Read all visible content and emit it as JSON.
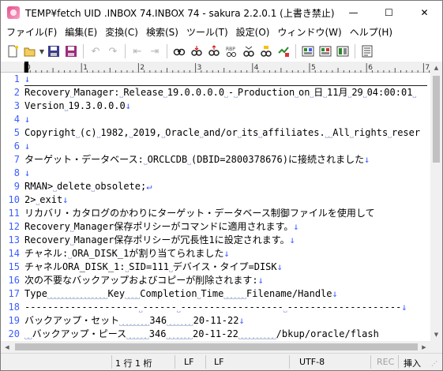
{
  "title": "TEMP¥fetch UID .INBOX 74.INBOX 74 - sakura 2.2.0.1 (上書き禁止)",
  "window_controls": [
    "—",
    "☐",
    "✕"
  ],
  "menu": [
    "ファイル(F)",
    "編集(E)",
    "変換(C)",
    "検索(S)",
    "ツール(T)",
    "設定(O)",
    "ウィンドウ(W)",
    "ヘルプ(H)"
  ],
  "toolbar": {
    "icons": [
      "new-file",
      "open",
      "save",
      "save-all",
      "undo",
      "redo",
      "jump-back",
      "jump-forward",
      "search",
      "search-next",
      "search-prev",
      "replace",
      "bookmark",
      "jump",
      "grep",
      "tag",
      "compare",
      "outline"
    ]
  },
  "ruler": {
    "labels": [
      "0",
      "1",
      "2",
      "3",
      "4",
      "5",
      "6",
      "7"
    ]
  },
  "lines": [
    {
      "n": "1",
      "t": "↓"
    },
    {
      "n": "2",
      "t": "Recovery˽Manager:˽Release˽19.0.0.0.0˽-˽Production˽on˽日˽11月˽29˽04:00:01˽"
    },
    {
      "n": "3",
      "t": "Version˽19.3.0.0.0↓"
    },
    {
      "n": "4",
      "t": "↓"
    },
    {
      "n": "5",
      "t": "Copyright˽(c)˽1982,˽2019,˽Oracle˽and/or˽its˽affiliates.˽˽All˽rights˽reser"
    },
    {
      "n": "6",
      "t": "↓"
    },
    {
      "n": "7",
      "t": "ターゲット・データベース:˽ORCLCDB˽(DBID=2800378676)に接続されました↓"
    },
    {
      "n": "8",
      "t": "↓"
    },
    {
      "n": "9",
      "t": "RMAN>˽delete˽obsolete;↵"
    },
    {
      "n": "10",
      "t": "2>˽exit↓"
    },
    {
      "n": "11",
      "t": "リカバリ・カタログのかわりにターゲット・データベース制御ファイルを使用して"
    },
    {
      "n": "12",
      "t": "Recovery˽Manager保存ポリシーがコマンドに適用されます。↓"
    },
    {
      "n": "13",
      "t": "Recovery˽Manager保存ポリシーが冗長性1に設定されます。↓"
    },
    {
      "n": "14",
      "t": "チャネル:˽ORA_DISK_1が割り当てられました↓"
    },
    {
      "n": "15",
      "t": "チャネルORA_DISK_1:˽SID=111˽デバイス・タイプ=DISK↓"
    },
    {
      "n": "16",
      "t": "次の不要なバックアップおよびコピーが削除されます:↓"
    },
    {
      "n": "17",
      "t": "Type˽˽˽˽˽˽˽˽˽˽˽˽˽˽˽˽Key˽˽˽˽Completion˽Time˽˽˽˽˽˽Filename/Handle↓"
    },
    {
      "n": "18",
      "t": "--------------------˽------˽------------------˽--------------------↓"
    },
    {
      "n": "19",
      "t": "バックアップ・セット˽˽˽˽˽˽˽˽346˽˽˽˽˽˽˽20-11-22↓"
    },
    {
      "n": "20",
      "t": "˽˽バックアップ・ピース˽˽˽˽˽˽346˽˽˽˽˽˽˽20-11-22˽˽˽˽˽˽˽˽˽˽/bkup/oracle/flash"
    }
  ],
  "status": {
    "position": "1 行   1 桁",
    "eol1": "LF",
    "eol2": "LF",
    "encoding": "UTF-8",
    "rec": "REC",
    "insert": "挿入"
  },
  "colors": {
    "line_number": "#3b5dff",
    "eol_mark": "#3b5dff",
    "space_mark": "#8fa0c8"
  }
}
